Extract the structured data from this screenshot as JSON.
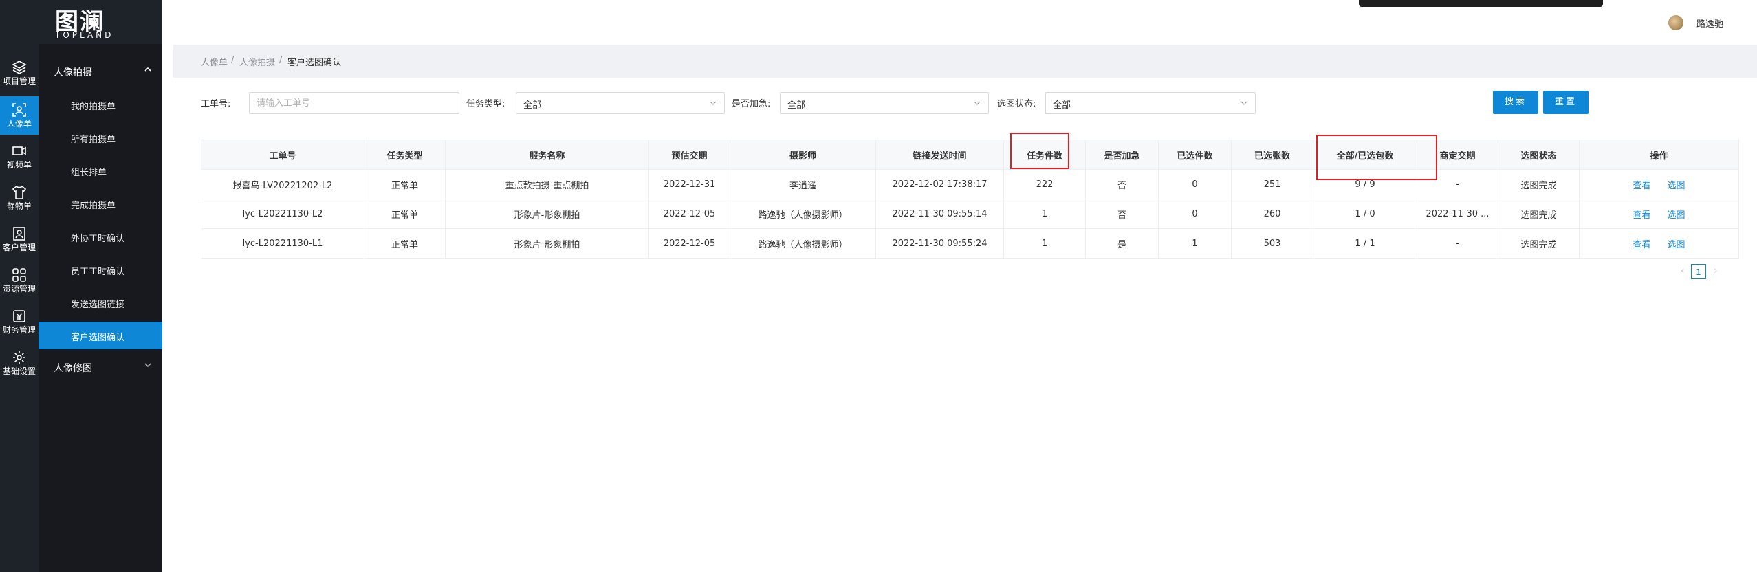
{
  "brand": {
    "logo_text": "图澜",
    "logo_sub": "TOPLAND"
  },
  "rail": [
    {
      "label": "项目管理",
      "icon": "layers-icon"
    },
    {
      "label": "人像单",
      "icon": "portrait-icon",
      "active": true
    },
    {
      "label": "视频单",
      "icon": "video-icon"
    },
    {
      "label": "静物单",
      "icon": "shirt-icon"
    },
    {
      "label": "客户管理",
      "icon": "customer-icon"
    },
    {
      "label": "资源管理",
      "icon": "grid-icon"
    },
    {
      "label": "财务管理",
      "icon": "finance-icon"
    },
    {
      "label": "基础设置",
      "icon": "gear-icon"
    }
  ],
  "subnav": {
    "group1": "人像拍摄",
    "items": [
      "我的拍摄单",
      "所有拍摄单",
      "组长排单",
      "完成拍摄单",
      "外协工时确认",
      "员工工时确认",
      "发送选图链接",
      "客户选图确认"
    ],
    "group2": "人像修图"
  },
  "user": {
    "name": "路逸驰"
  },
  "breadcrumb": {
    "level1": "人像单",
    "sep": "/",
    "level2": "人像拍摄",
    "current": "客户选图确认"
  },
  "filters": {
    "order_label": "工单号:",
    "order_placeholder": "请输入工单号",
    "task_type_label": "任务类型:",
    "task_type_value": "全部",
    "urgent_label": "是否加急:",
    "urgent_value": "全部",
    "status_label": "选图状态:",
    "status_value": "全部",
    "search_btn": "搜索",
    "reset_btn": "重置"
  },
  "table": {
    "headers": [
      "工单号",
      "任务类型",
      "服务名称",
      "预估交期",
      "摄影师",
      "链接发送时间",
      "任务件数",
      "是否加急",
      "已选件数",
      "已选张数",
      "全部/已选包数",
      "商定交期",
      "选图状态",
      "操作"
    ],
    "rows": [
      [
        "报喜鸟-LV20221202-L2",
        "正常单",
        "重点款拍摄-重点棚拍",
        "2022-12-31",
        "李逍遥",
        "2022-12-02 17:38:17",
        "222",
        "否",
        "0",
        "251",
        "9 / 9",
        "-",
        "选图完成"
      ],
      [
        "lyc-L20221130-L2",
        "正常单",
        "形象片-形象棚拍",
        "2022-12-05",
        "路逸驰（人像摄影师）",
        "2022-11-30 09:55:14",
        "1",
        "否",
        "0",
        "260",
        "1 / 0",
        "2022-11-30 ...",
        "选图完成"
      ],
      [
        "lyc-L20221130-L1",
        "正常单",
        "形象片-形象棚拍",
        "2022-12-05",
        "路逸驰（人像摄影师）",
        "2022-11-30 09:55:24",
        "1",
        "是",
        "1",
        "503",
        "1 / 1",
        "-",
        "选图完成"
      ]
    ],
    "actions": {
      "view": "查看",
      "select": "选图"
    }
  },
  "pagination": {
    "current": "1",
    "prev": "‹",
    "next": "›"
  },
  "colors": {
    "accent": "#0e88d6",
    "rail_bg": "#1e2329",
    "highlight": "#e02020"
  }
}
